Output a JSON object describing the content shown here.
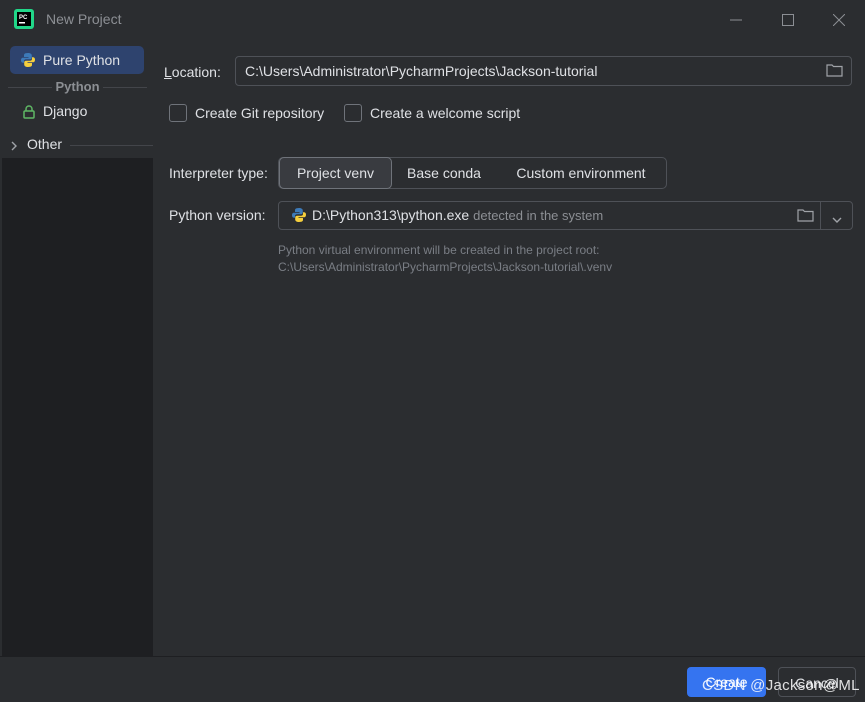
{
  "window": {
    "title": "New Project"
  },
  "sidebar": {
    "selected_item": "Pure Python",
    "group_heading": "Python",
    "django_label": "Django",
    "other_label": "Other"
  },
  "location": {
    "label": "Location:",
    "label_mnemonic": "L",
    "label_rest": "ocation:",
    "value": "C:\\Users\\Administrator\\PycharmProjects\\Jackson-tutorial"
  },
  "options": {
    "git_label": "Create Git repository",
    "git_checked": false,
    "welcome_label": "Create a welcome script",
    "welcome_checked": false
  },
  "interpreter": {
    "label": "Interpreter type:",
    "types": [
      "Project venv",
      "Base conda",
      "Custom environment"
    ],
    "selected": "Project venv"
  },
  "python_version": {
    "label": "Python version:",
    "path": "D:\\Python313\\python.exe",
    "hint": "detected in the system"
  },
  "note": {
    "line1": "Python virtual environment will be created in the project root:",
    "line2": "C:\\Users\\Administrator\\PycharmProjects\\Jackson-tutorial\\.venv"
  },
  "footer": {
    "create_label": "Create",
    "cancel_label": "Cancel"
  },
  "watermark": "CSDN @Jackson@ML",
  "colors": {
    "accent": "#3574f0",
    "selected_bg": "#2e436e",
    "background": "#2b2d30",
    "sidebar_bg": "#1e1f22"
  }
}
